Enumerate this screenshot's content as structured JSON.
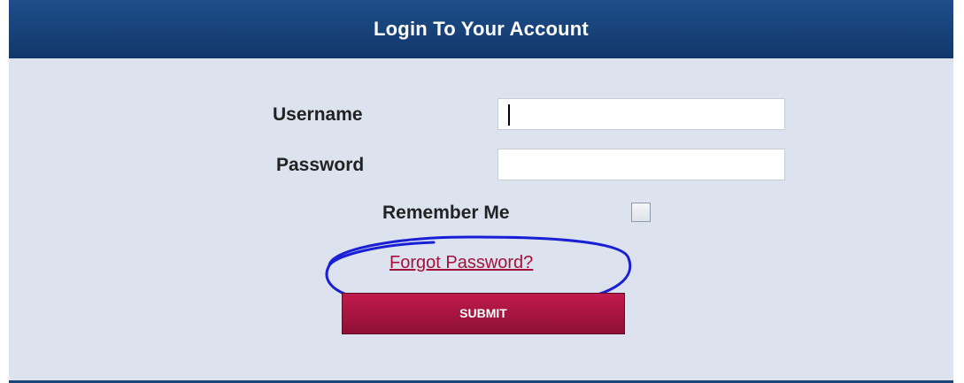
{
  "header": {
    "title": "Login To Your Account"
  },
  "form": {
    "username_label": "Username",
    "username_value": "",
    "password_label": "Password",
    "password_value": "",
    "remember_label": "Remember Me",
    "remember_checked": false,
    "forgot_link": "Forgot Password?",
    "submit_label": "SUBMIT"
  },
  "colors": {
    "header_bg": "#173f73",
    "panel_bg": "#dce3ee",
    "link": "#a3123c",
    "submit_bg": "#a0143f",
    "annotation_circle": "#1a1fd6"
  },
  "annotation": {
    "shape": "hand-drawn-circle",
    "target": "forgot-password-link"
  }
}
